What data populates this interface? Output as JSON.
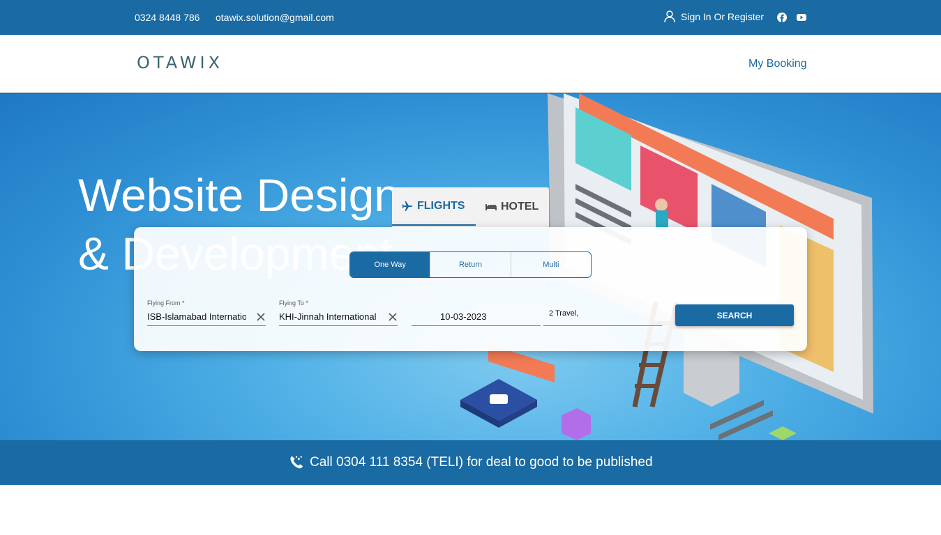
{
  "topbar": {
    "phone": "0324 8448 786",
    "email": "otawix.solution@gmail.com",
    "signin_label": "Sign In Or Register",
    "icons": [
      "user-icon",
      "facebook-icon",
      "youtube-icon"
    ]
  },
  "nav": {
    "logo": "OTAWIX",
    "my_booking": "My Booking"
  },
  "hero": {
    "title_line1": "Website Design",
    "title_line2": "& Development"
  },
  "search": {
    "tabs": [
      {
        "label": "FLIGHTS",
        "icon": "plane-icon",
        "active": true
      },
      {
        "label": "HOTEL",
        "icon": "bed-icon",
        "active": false
      }
    ],
    "trip_types": [
      "One Way",
      "Return",
      "Multi"
    ],
    "selected_trip": "One Way",
    "flying_from_label": "Flying From *",
    "flying_from_value": "ISB-Islamabad International",
    "flying_to_label": "Flying To *",
    "flying_to_value": "KHI-Jinnah International",
    "date_value": "10-03-2023",
    "travellers_value": "2  Travel,",
    "search_button": "SEARCH"
  },
  "callbar": {
    "text": "Call 0304 111 8354 (TELI) for deal to good to be published"
  },
  "colors": {
    "primary": "#1a6aa3",
    "logo": "#3a6672"
  }
}
